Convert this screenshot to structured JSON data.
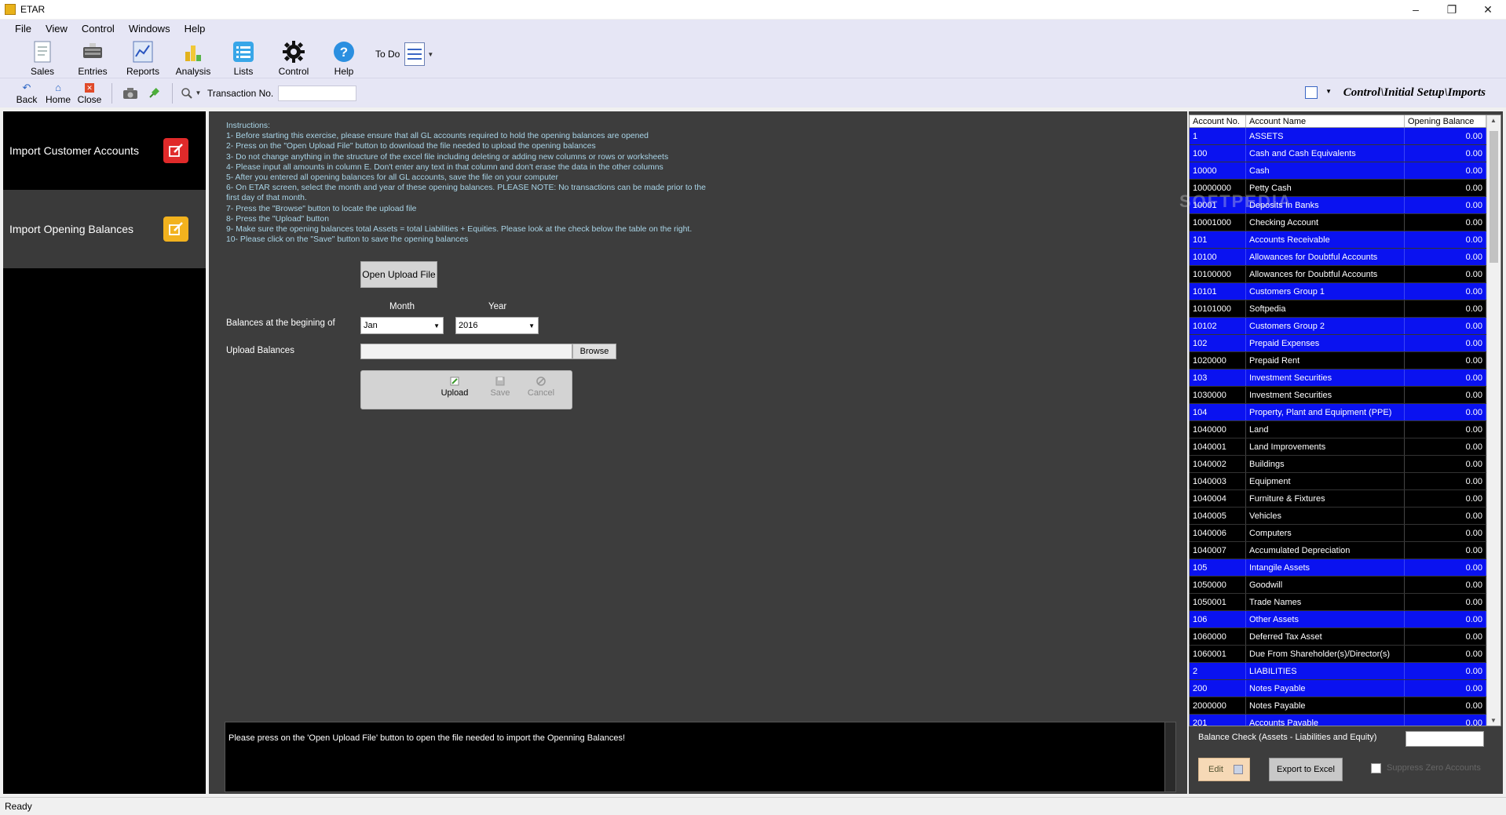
{
  "window": {
    "title": "ETAR"
  },
  "menu": [
    "File",
    "View",
    "Control",
    "Windows",
    "Help"
  ],
  "ribbon": [
    {
      "label": "Sales",
      "icon": "sales-icon"
    },
    {
      "label": "Entries",
      "icon": "entries-icon"
    },
    {
      "label": "Reports",
      "icon": "reports-icon"
    },
    {
      "label": "Analysis",
      "icon": "analysis-icon"
    },
    {
      "label": "Lists",
      "icon": "lists-icon"
    },
    {
      "label": "Control",
      "icon": "gear-icon"
    },
    {
      "label": "Help",
      "icon": "help-icon"
    }
  ],
  "todo_label": "To Do",
  "toolbar": {
    "back": "Back",
    "home": "Home",
    "close": "Close",
    "transaction_label": "Transaction No.",
    "transaction_value": "",
    "breadcrumb": "Control\\Initial Setup\\Imports"
  },
  "left": {
    "items": [
      {
        "label": "Import Customer Accounts"
      },
      {
        "label": "Import Opening Balances"
      }
    ]
  },
  "center": {
    "instructions": [
      "Instructions:",
      "1- Before starting this exercise, please ensure that all GL accounts required to hold the opening balances are opened",
      "2- Press on the \"Open Upload File\" button to download the file needed to upload the opening balances",
      "3- Do not change anything in the structure of the excel file including deleting or adding new columns or rows or worksheets",
      "4- Please input all amounts in column E. Don't enter any text in that column and don't erase the data in the other columns",
      "5- After you entered all opening balances for all GL accounts, save the file on your computer",
      "6- On ETAR screen, select the month and year of these opening balances. PLEASE NOTE: No transactions can be made prior to the",
      "first day of that month.",
      "7- Press the \"Browse\" button to locate the upload file",
      "8- Press the \"Upload\" button",
      "9- Make sure the opening balances total Assets = total Liabilities + Equities. Please look at the check below the table on the right.",
      "10- Please click on the \"Save\" button to save the opening balances"
    ],
    "open_upload_label": "Open Upload File",
    "month_label": "Month",
    "year_label": "Year",
    "balances_label": "Balances at the begining of",
    "month_value": "Jan",
    "year_value": "2016",
    "upload_balances_label": "Upload Balances",
    "upload_path": "",
    "browse_label": "Browse",
    "upload_label": "Upload",
    "save_label": "Save",
    "cancel_label": "Cancel",
    "message": "Please press on the 'Open Upload File' button to open the file needed to import the Openning Balances!"
  },
  "grid": {
    "columns": [
      "Account No.",
      "Account Name",
      "Opening Balance"
    ],
    "rows": [
      {
        "no": "1",
        "name": "ASSETS",
        "bal": "0.00",
        "style": "blue"
      },
      {
        "no": "100",
        "name": "Cash and Cash Equivalents",
        "bal": "0.00",
        "style": "blue"
      },
      {
        "no": "10000",
        "name": "Cash",
        "bal": "0.00",
        "style": "blue"
      },
      {
        "no": "10000000",
        "name": "Petty Cash",
        "bal": "0.00",
        "style": "black"
      },
      {
        "no": "10001",
        "name": "Deposits In Banks",
        "bal": "0.00",
        "style": "blue"
      },
      {
        "no": "10001000",
        "name": "Checking Account",
        "bal": "0.00",
        "style": "black"
      },
      {
        "no": "101",
        "name": "Accounts Receivable",
        "bal": "0.00",
        "style": "blue"
      },
      {
        "no": "10100",
        "name": "Allowances for Doubtful Accounts",
        "bal": "0.00",
        "style": "blue"
      },
      {
        "no": "10100000",
        "name": "Allowances for Doubtful Accounts",
        "bal": "0.00",
        "style": "black"
      },
      {
        "no": "10101",
        "name": "Customers Group 1",
        "bal": "0.00",
        "style": "blue"
      },
      {
        "no": "10101000",
        "name": "Softpedia",
        "bal": "0.00",
        "style": "black"
      },
      {
        "no": "10102",
        "name": "Customers Group 2",
        "bal": "0.00",
        "style": "blue"
      },
      {
        "no": "102",
        "name": "Prepaid Expenses",
        "bal": "0.00",
        "style": "blue"
      },
      {
        "no": "1020000",
        "name": "Prepaid Rent",
        "bal": "0.00",
        "style": "black"
      },
      {
        "no": "103",
        "name": "Investment Securities",
        "bal": "0.00",
        "style": "blue"
      },
      {
        "no": "1030000",
        "name": "Investment Securities",
        "bal": "0.00",
        "style": "black"
      },
      {
        "no": "104",
        "name": "Property, Plant and Equipment (PPE)",
        "bal": "0.00",
        "style": "blue"
      },
      {
        "no": "1040000",
        "name": "Land",
        "bal": "0.00",
        "style": "black"
      },
      {
        "no": "1040001",
        "name": "Land Improvements",
        "bal": "0.00",
        "style": "black"
      },
      {
        "no": "1040002",
        "name": "Buildings",
        "bal": "0.00",
        "style": "black"
      },
      {
        "no": "1040003",
        "name": "Equipment",
        "bal": "0.00",
        "style": "black"
      },
      {
        "no": "1040004",
        "name": "Furniture & Fixtures",
        "bal": "0.00",
        "style": "black"
      },
      {
        "no": "1040005",
        "name": "Vehicles",
        "bal": "0.00",
        "style": "black"
      },
      {
        "no": "1040006",
        "name": "Computers",
        "bal": "0.00",
        "style": "black"
      },
      {
        "no": "1040007",
        "name": "Accumulated Depreciation",
        "bal": "0.00",
        "style": "black"
      },
      {
        "no": "105",
        "name": "Intangile Assets",
        "bal": "0.00",
        "style": "blue"
      },
      {
        "no": "1050000",
        "name": "Goodwill",
        "bal": "0.00",
        "style": "black"
      },
      {
        "no": "1050001",
        "name": "Trade Names",
        "bal": "0.00",
        "style": "black"
      },
      {
        "no": "106",
        "name": "Other Assets",
        "bal": "0.00",
        "style": "blue"
      },
      {
        "no": "1060000",
        "name": "Deferred Tax Asset",
        "bal": "0.00",
        "style": "black"
      },
      {
        "no": "1060001",
        "name": "Due From Shareholder(s)/Director(s)",
        "bal": "0.00",
        "style": "black"
      },
      {
        "no": "2",
        "name": "LIABILITIES",
        "bal": "0.00",
        "style": "blue"
      },
      {
        "no": "200",
        "name": "Notes Payable",
        "bal": "0.00",
        "style": "blue"
      },
      {
        "no": "2000000",
        "name": "Notes Payable",
        "bal": "0.00",
        "style": "black"
      },
      {
        "no": "201",
        "name": "Accounts Payable",
        "bal": "0.00",
        "style": "blue"
      }
    ]
  },
  "balance_check_label": "Balance Check (Assets - Liabilities and Equity)",
  "balance_check_value": "",
  "edit_label": "Edit",
  "export_label": "Export to Excel",
  "suppress_label": "Suppress Zero Accounts",
  "watermark": "SOFTPEDIA",
  "status": "Ready",
  "colors": {
    "row_blue": "#0a12f0",
    "row_black": "#000000",
    "panel": "#3d3d3d",
    "instructions": "#a9d5e8"
  }
}
